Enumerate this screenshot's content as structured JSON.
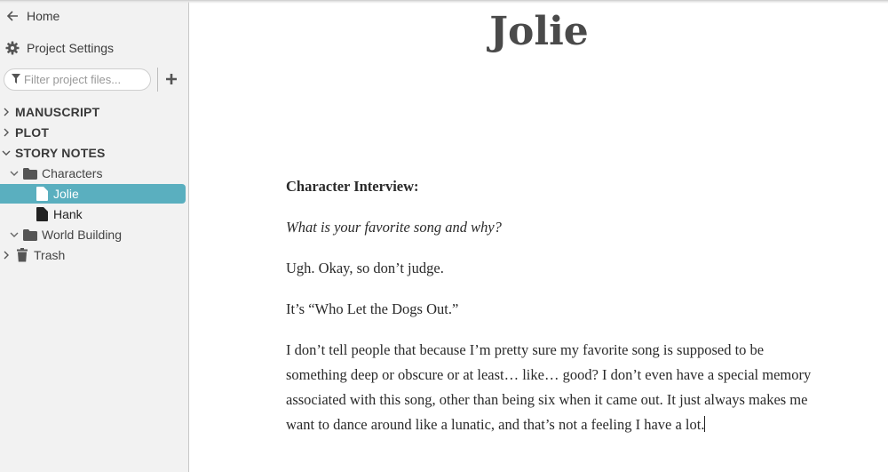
{
  "sidebar": {
    "home_label": "Home",
    "settings_label": "Project Settings",
    "filter_placeholder": "Filter project files...",
    "add_label": "+",
    "tree": {
      "manuscript": "MANUSCRIPT",
      "plot": "PLOT",
      "story_notes": "STORY NOTES",
      "characters": "Characters",
      "jolie": "Jolie",
      "hank": "Hank",
      "world_building": "World Building",
      "trash": "Trash"
    },
    "colors": {
      "selected": "#5aafbf"
    }
  },
  "document": {
    "title": "Jolie",
    "heading": "Character Interview:",
    "question": "What is your favorite song and why?",
    "paragraphs": [
      "Ugh. Okay, so don’t judge.",
      "It’s “Who Let the Dogs Out.”",
      "I don’t tell people that because I’m pretty sure my favorite song is supposed to be something deep or obscure or at least… like… good? I don’t even have a special memory associated with this song, other than being six when it came out. It just always makes me want to dance around like a lunatic, and that’s not a feeling I have a lot."
    ]
  }
}
